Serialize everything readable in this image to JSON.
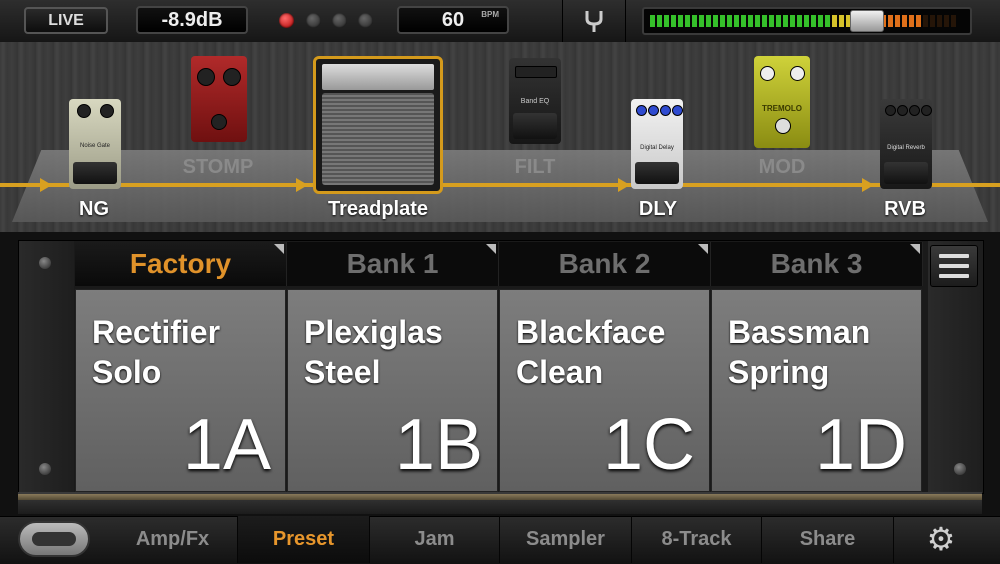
{
  "topbar": {
    "live_label": "LIVE",
    "input_level": "-8.9dB",
    "tempo_value": "60",
    "tempo_unit": "BPM",
    "tuner_icon": "tuning-fork-icon",
    "meter_colors": {
      "low": "#35c02a",
      "mid": "#d6c22a",
      "high": "#e0701a"
    }
  },
  "signal_chain": {
    "line_color": "#d8a020",
    "slots": [
      {
        "label": "NG",
        "active": true
      },
      {
        "label": "STOMP",
        "active": false
      },
      {
        "label": "Treadplate",
        "active": true
      },
      {
        "label": "FILT",
        "active": false
      },
      {
        "label": "DLY",
        "active": true
      },
      {
        "label": "MOD",
        "active": false
      },
      {
        "label": "RVB",
        "active": true
      }
    ],
    "pedal_texts": {
      "noise_gate": "Noise Gate",
      "eq": "Band EQ",
      "delay": "Digital Delay",
      "tremolo": "TREMOLO",
      "reverb": "Digital Reverb"
    }
  },
  "banks": {
    "tabs": [
      {
        "label": "Factory",
        "active": true
      },
      {
        "label": "Bank 1",
        "active": false
      },
      {
        "label": "Bank 2",
        "active": false
      },
      {
        "label": "Bank 3",
        "active": false
      }
    ],
    "presets": [
      {
        "name": "Rectifier\nSolo",
        "number": "1A"
      },
      {
        "name": "Plexiglas\nSteel",
        "number": "1B"
      },
      {
        "name": "Blackface\nClean",
        "number": "1C"
      },
      {
        "name": "Bassman\nSpring",
        "number": "1D"
      }
    ],
    "accent_color": "#e0922a"
  },
  "bottom_nav": {
    "items": [
      {
        "label": "Amp/Fx",
        "active": false
      },
      {
        "label": "Preset",
        "active": true
      },
      {
        "label": "Jam",
        "active": false
      },
      {
        "label": "Sampler",
        "active": false
      },
      {
        "label": "8-Track",
        "active": false
      },
      {
        "label": "Share",
        "active": false
      }
    ],
    "settings_icon": "gear-icon",
    "footswitch_icon": "footswitch-icon"
  }
}
